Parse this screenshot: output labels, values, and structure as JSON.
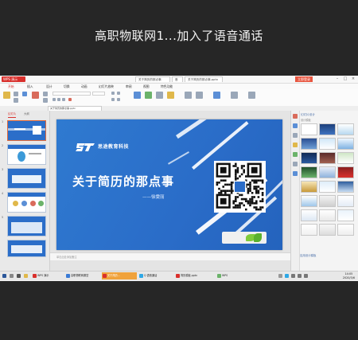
{
  "call": {
    "title": "高职物联网1...加入了语音通话"
  },
  "wps": {
    "app_tab": "WPS 演示",
    "doc_tabs": [
      "关于简历的那点事",
      "首页",
      "关于简历的那点事.pptx"
    ],
    "login": "立即登录",
    "menu": [
      "开始",
      "插入",
      "设计",
      "切换",
      "动画",
      "幻灯片放映",
      "审阅",
      "视图",
      "特色功能"
    ],
    "active_menu": "开始",
    "file_tab": "关于简历的那点事.pptx",
    "left_panel_tabs": [
      "幻灯片",
      "大纲"
    ],
    "slide_numbers": [
      "1",
      "2",
      "3",
      "4",
      "5"
    ]
  },
  "slide": {
    "logo_text": "思途教育科技",
    "title": "关于简历的那点事",
    "author": "——徐雯丽"
  },
  "right_pane": {
    "title": "幻灯片设计",
    "subtitle": "设计模板",
    "bottom_link": "应用设计模板"
  },
  "status": {
    "slide_info": "幻灯片 1 / 19",
    "notes_placeholder": "单击此处添加备注"
  },
  "taskbar": {
    "items": [
      {
        "label": "WPS 演示",
        "color": "#d9302c",
        "active": false
      },
      {
        "label": "高职物联网课堂",
        "color": "#3a7bd5",
        "active": false
      },
      {
        "label": "关于简历...",
        "color": "#d9302c",
        "active": true
      },
      {
        "label": "Q 语音通话",
        "color": "#2ea8e6",
        "active": false
      },
      {
        "label": "简历模板.pptx",
        "color": "#d9302c",
        "active": false
      },
      {
        "label": "WPS",
        "color": "#6bb36a",
        "active": false
      }
    ],
    "time": "14:05",
    "date": "2020/3/6"
  },
  "colors": {
    "accent": "#d9302c",
    "slide_blue": "#2a6cc8",
    "taskbar_active": "#f0a23b"
  }
}
